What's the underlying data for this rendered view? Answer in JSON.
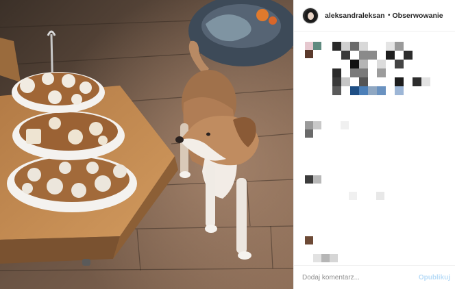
{
  "post": {
    "username": "aleksandraleksanc",
    "separator": "•",
    "follow_label": "Obserwowanie"
  },
  "comment": {
    "placeholder": "Dodaj komentarz...",
    "publish_label": "Opublikuj"
  }
}
